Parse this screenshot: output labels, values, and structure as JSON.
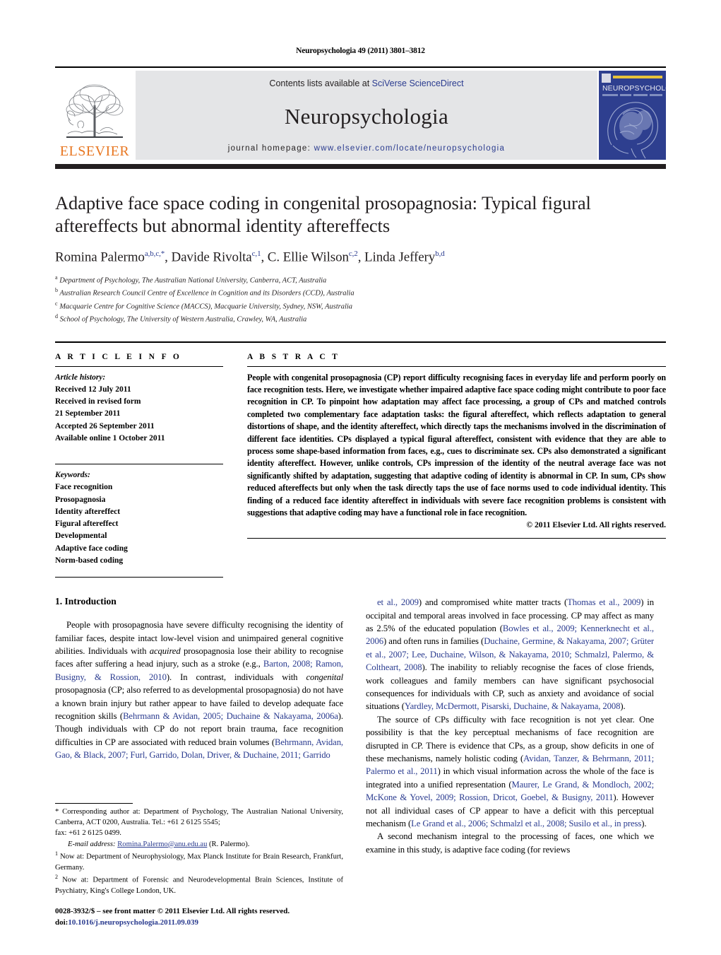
{
  "running_head": "Neuropsychologia 49 (2011) 3801–3812",
  "masthead": {
    "publisher_logo_name": "elsevier-tree-logo",
    "publisher_wordmark": "ELSEVIER",
    "contents_prefix": "Contents lists available at ",
    "contents_link": "SciVerse ScienceDirect",
    "journal_name": "Neuropsychologia",
    "homepage_prefix": "journal homepage: ",
    "homepage_url": "www.elsevier.com/locate/neuropsychologia",
    "cover_title": "NEUROPSYCHOLOGIA"
  },
  "title": "Adaptive face space coding in congenital prosopagnosia: Typical figural aftereffects but abnormal identity aftereffects",
  "authors_html": "Romina Palermo<sup>a,b,c,*</sup>, Davide Rivolta<sup>c,1</sup>, C. Ellie Wilson<sup>c,2</sup>, Linda Jeffery<sup>b,d</sup>",
  "affiliations": [
    {
      "marker": "a",
      "text": "Department of Psychology, The Australian National University, Canberra, ACT, Australia"
    },
    {
      "marker": "b",
      "text": "Australian Research Council Centre of Excellence in Cognition and its Disorders (CCD), Australia"
    },
    {
      "marker": "c",
      "text": "Macquarie Centre for Cognitive Science (MACCS), Macquarie University, Sydney, NSW, Australia"
    },
    {
      "marker": "d",
      "text": "School of Psychology, The University of Western Australia, Crawley, WA, Australia"
    }
  ],
  "article_info": {
    "heading": "A R T I C L E    I N F O",
    "history_label": "Article history:",
    "history_lines": [
      "Received 12 July 2011",
      "Received in revised form",
      "21 September 2011",
      "Accepted 26 September 2011",
      "Available online 1 October 2011"
    ],
    "keywords_label": "Keywords:",
    "keywords": [
      "Face recognition",
      "Prosopagnosia",
      "Identity aftereffect",
      "Figural aftereffect",
      "Developmental",
      "Adaptive face coding",
      "Norm-based coding"
    ]
  },
  "abstract": {
    "heading": "A B S T R A C T",
    "text": "People with congenital prosopagnosia (CP) report difficulty recognising faces in everyday life and perform poorly on face recognition tests. Here, we investigate whether impaired adaptive face space coding might contribute to poor face recognition in CP. To pinpoint how adaptation may affect face processing, a group of CPs and matched controls completed two complementary face adaptation tasks: the figural aftereffect, which reflects adaptation to general distortions of shape, and the identity aftereffect, which directly taps the mechanisms involved in the discrimination of different face identities. CPs displayed a typical figural aftereffect, consistent with evidence that they are able to process some shape-based information from faces, e.g., cues to discriminate sex. CPs also demonstrated a significant identity aftereffect. However, unlike controls, CPs impression of the identity of the neutral average face was not significantly shifted by adaptation, suggesting that adaptive coding of identity is abnormal in CP. In sum, CPs show reduced aftereffects but only when the task directly taps the use of face norms used to code individual identity. This finding of a reduced face identity aftereffect in individuals with severe face recognition problems is consistent with suggestions that adaptive coding may have a functional role in face recognition.",
    "copyright": "© 2011 Elsevier Ltd. All rights reserved."
  },
  "body": {
    "section_title": "1.  Introduction",
    "left_paragraphs": [
      "People with prosopagnosia have severe difficulty recognising the identity of familiar faces, despite intact low-level vision and unimpaired general cognitive abilities. Individuals with <span class=\"it\">acquired</span> prosopagnosia lose their ability to recognise faces after suffering a head injury, such as a stroke (e.g., <span class=\"ref\">Barton, 2008; Ramon, Busigny, &amp; Rossion, 2010</span>). In contrast, individuals with <span class=\"it\">congenital</span> prosopagnosia (CP; also referred to as developmental prosopagnosia) do not have a known brain injury but rather appear to have failed to develop adequate face recognition skills (<span class=\"ref\">Behrmann &amp; Avidan, 2005; Duchaine &amp; Nakayama, 2006a</span>). Though individuals with CP do not report brain trauma, face recognition difficulties in CP are associated with reduced brain volumes (<span class=\"ref\">Behrmann, Avidan, Gao, &amp; Black, 2007; Furl, Garrido, Dolan, Driver, &amp; Duchaine, 2011; Garrido</span>"
    ],
    "right_paragraphs": [
      "<span class=\"ref\">et al., 2009</span>) and compromised white matter tracts (<span class=\"ref\">Thomas et al., 2009</span>) in occipital and temporal areas involved in face processing. CP may affect as many as 2.5% of the educated population (<span class=\"ref\">Bowles et al., 2009; Kennerknecht et al., 2006</span>) and often runs in families (<span class=\"ref\">Duchaine, Germine, &amp; Nakayama, 2007; Grüter et al., 2007; Lee, Duchaine, Wilson, &amp; Nakayama, 2010; Schmalzl, Palermo, &amp; Coltheart, 2008</span>). The inability to reliably recognise the faces of close friends, work colleagues and family members can have significant psychosocial consequences for individuals with CP, such as anxiety and avoidance of social situations (<span class=\"ref\">Yardley, McDermott, Pisarski, Duchaine, &amp; Nakayama, 2008</span>).",
      "The source of CPs difficulty with face recognition is not yet clear. One possibility is that the key perceptual mechanisms of face recognition are disrupted in CP. There is evidence that CPs, as a group, show deficits in one of these mechanisms, namely holistic coding (<span class=\"ref\">Avidan, Tanzer, &amp; Behrmann, 2011; Palermo et al., 2011</span>) in which visual information across the whole of the face is integrated into a unified representation (<span class=\"ref\">Maurer, Le Grand, &amp; Mondloch, 2002; McKone &amp; Yovel, 2009; Rossion, Dricot, Goebel, &amp; Busigny, 2011</span>). However not all individual cases of CP appear to have a deficit with this perceptual mechanism (<span class=\"ref\">Le Grand et al., 2006; Schmalzl et al., 2008; Susilo et al., in press</span>).",
      "A second mechanism integral to the processing of faces, one which we examine in this study, is adaptive face coding (for reviews"
    ]
  },
  "footnotes": {
    "corresponding": "* Corresponding author at: Department of Psychology, The Australian National University, Canberra, ACT 0200, Australia. Tel.: +61 2 6125 5545;",
    "fax": "fax: +61 2 6125 0499.",
    "email_label": "E-mail address:",
    "email": "Romina.Palermo@anu.edu.au",
    "email_suffix": "(R. Palermo).",
    "note1": "Now at: Department of Neurophysiology, Max Planck Institute for Brain Research, Frankfurt, Germany.",
    "note2": "Now at: Department of Forensic and Neurodevelopmental Brain Sciences, Institute of Psychiatry, King's College London, UK.",
    "issn_line": "0028-3932/$ – see front matter © 2011 Elsevier Ltd. All rights reserved.",
    "doi_label": "doi:",
    "doi": "10.1016/j.neuropsychologia.2011.09.039"
  },
  "colors": {
    "link_blue": "#2a3b8f",
    "elsevier_orange": "#E87722",
    "band_gray": "#e4e5e7",
    "cover_blue": "#2e3f8f",
    "rule_black": "#231f20"
  }
}
